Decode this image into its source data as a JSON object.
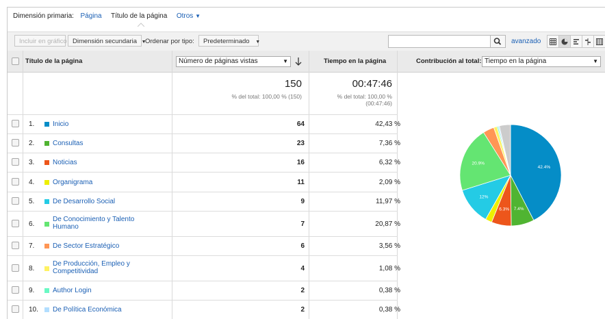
{
  "primary_dimension": {
    "label": "Dimensión primaria:",
    "options": [
      "Página",
      "Título de la página",
      "Otros"
    ]
  },
  "toolbar": {
    "plot_rows": "Incluir en gráfico",
    "secondary_dimension": "Dimensión secundaria",
    "sort_label": "Ordenar por tipo:",
    "sort_value": "Predeterminado",
    "search_placeholder": "",
    "advanced": "avanzado"
  },
  "table": {
    "col_title": "Título de la página",
    "col_metric_select": "Número de páginas vistas",
    "col_time": "Tiempo en la página",
    "contribution_label": "Contribución al total:",
    "contribution_value": "Tiempo en la página",
    "totals": {
      "pageviews": "150",
      "pageviews_sub": "% del total: 100,00 % (150)",
      "time": "00:47:46",
      "time_sub1": "% del total: 100,00 %",
      "time_sub2": "(00:47:46)"
    },
    "rows": [
      {
        "idx": "1.",
        "name": "Inicio",
        "name2": "",
        "pv": "64",
        "time": "42,43 %",
        "color": "#058dc7"
      },
      {
        "idx": "2.",
        "name": "Consultas",
        "name2": "",
        "pv": "23",
        "time": "7,36 %",
        "color": "#50b432"
      },
      {
        "idx": "3.",
        "name": "Noticias",
        "name2": "",
        "pv": "16",
        "time": "6,32 %",
        "color": "#ed561b"
      },
      {
        "idx": "4.",
        "name": "Organigrama",
        "name2": "",
        "pv": "11",
        "time": "2,09 %",
        "color": "#edef00"
      },
      {
        "idx": "5.",
        "name": "De Desarrollo Social",
        "name2": "",
        "pv": "9",
        "time": "11,97 %",
        "color": "#24cbe5"
      },
      {
        "idx": "6.",
        "name": "De Conocimiento y Talento",
        "name2": "Humano",
        "pv": "7",
        "time": "20,87 %",
        "color": "#64e572"
      },
      {
        "idx": "7.",
        "name": "De Sector Estratégico",
        "name2": "",
        "pv": "6",
        "time": "3,56 %",
        "color": "#ff9655"
      },
      {
        "idx": "8.",
        "name": "De Producción, Empleo y",
        "name2": "Competitividad",
        "pv": "4",
        "time": "1,08 %",
        "color": "#fff263"
      },
      {
        "idx": "9.",
        "name": "Author Login",
        "name2": "",
        "pv": "2",
        "time": "0,38 %",
        "color": "#6af9c4"
      },
      {
        "idx": "10.",
        "name": "De Política Económica",
        "name2": "",
        "pv": "2",
        "time": "0,38 %",
        "color": "#b2deff"
      }
    ]
  },
  "chart_data": {
    "type": "pie",
    "title": "",
    "slices": [
      {
        "label": "Inicio",
        "value": 42.43,
        "color": "#058dc7",
        "shown_label": "42.4%"
      },
      {
        "label": "Consultas",
        "value": 7.36,
        "color": "#50b432",
        "shown_label": "7.4%"
      },
      {
        "label": "Noticias",
        "value": 6.32,
        "color": "#ed561b",
        "shown_label": "6.3%"
      },
      {
        "label": "Organigrama",
        "value": 2.09,
        "color": "#edef00",
        "shown_label": ""
      },
      {
        "label": "De Desarrollo Social",
        "value": 11.97,
        "color": "#24cbe5",
        "shown_label": "12%"
      },
      {
        "label": "De Conocimiento y Talento Humano",
        "value": 20.87,
        "color": "#64e572",
        "shown_label": "20.9%"
      },
      {
        "label": "De Sector Estratégico",
        "value": 3.56,
        "color": "#ff9655",
        "shown_label": ""
      },
      {
        "label": "De Producción, Empleo y Competitividad",
        "value": 1.08,
        "color": "#fff263",
        "shown_label": ""
      },
      {
        "label": "Author Login",
        "value": 0.38,
        "color": "#6af9c4",
        "shown_label": ""
      },
      {
        "label": "De Política Económica",
        "value": 0.38,
        "color": "#b2deff",
        "shown_label": ""
      },
      {
        "label": "Other",
        "value": 3.56,
        "color": "#cccccc",
        "shown_label": ""
      }
    ]
  }
}
